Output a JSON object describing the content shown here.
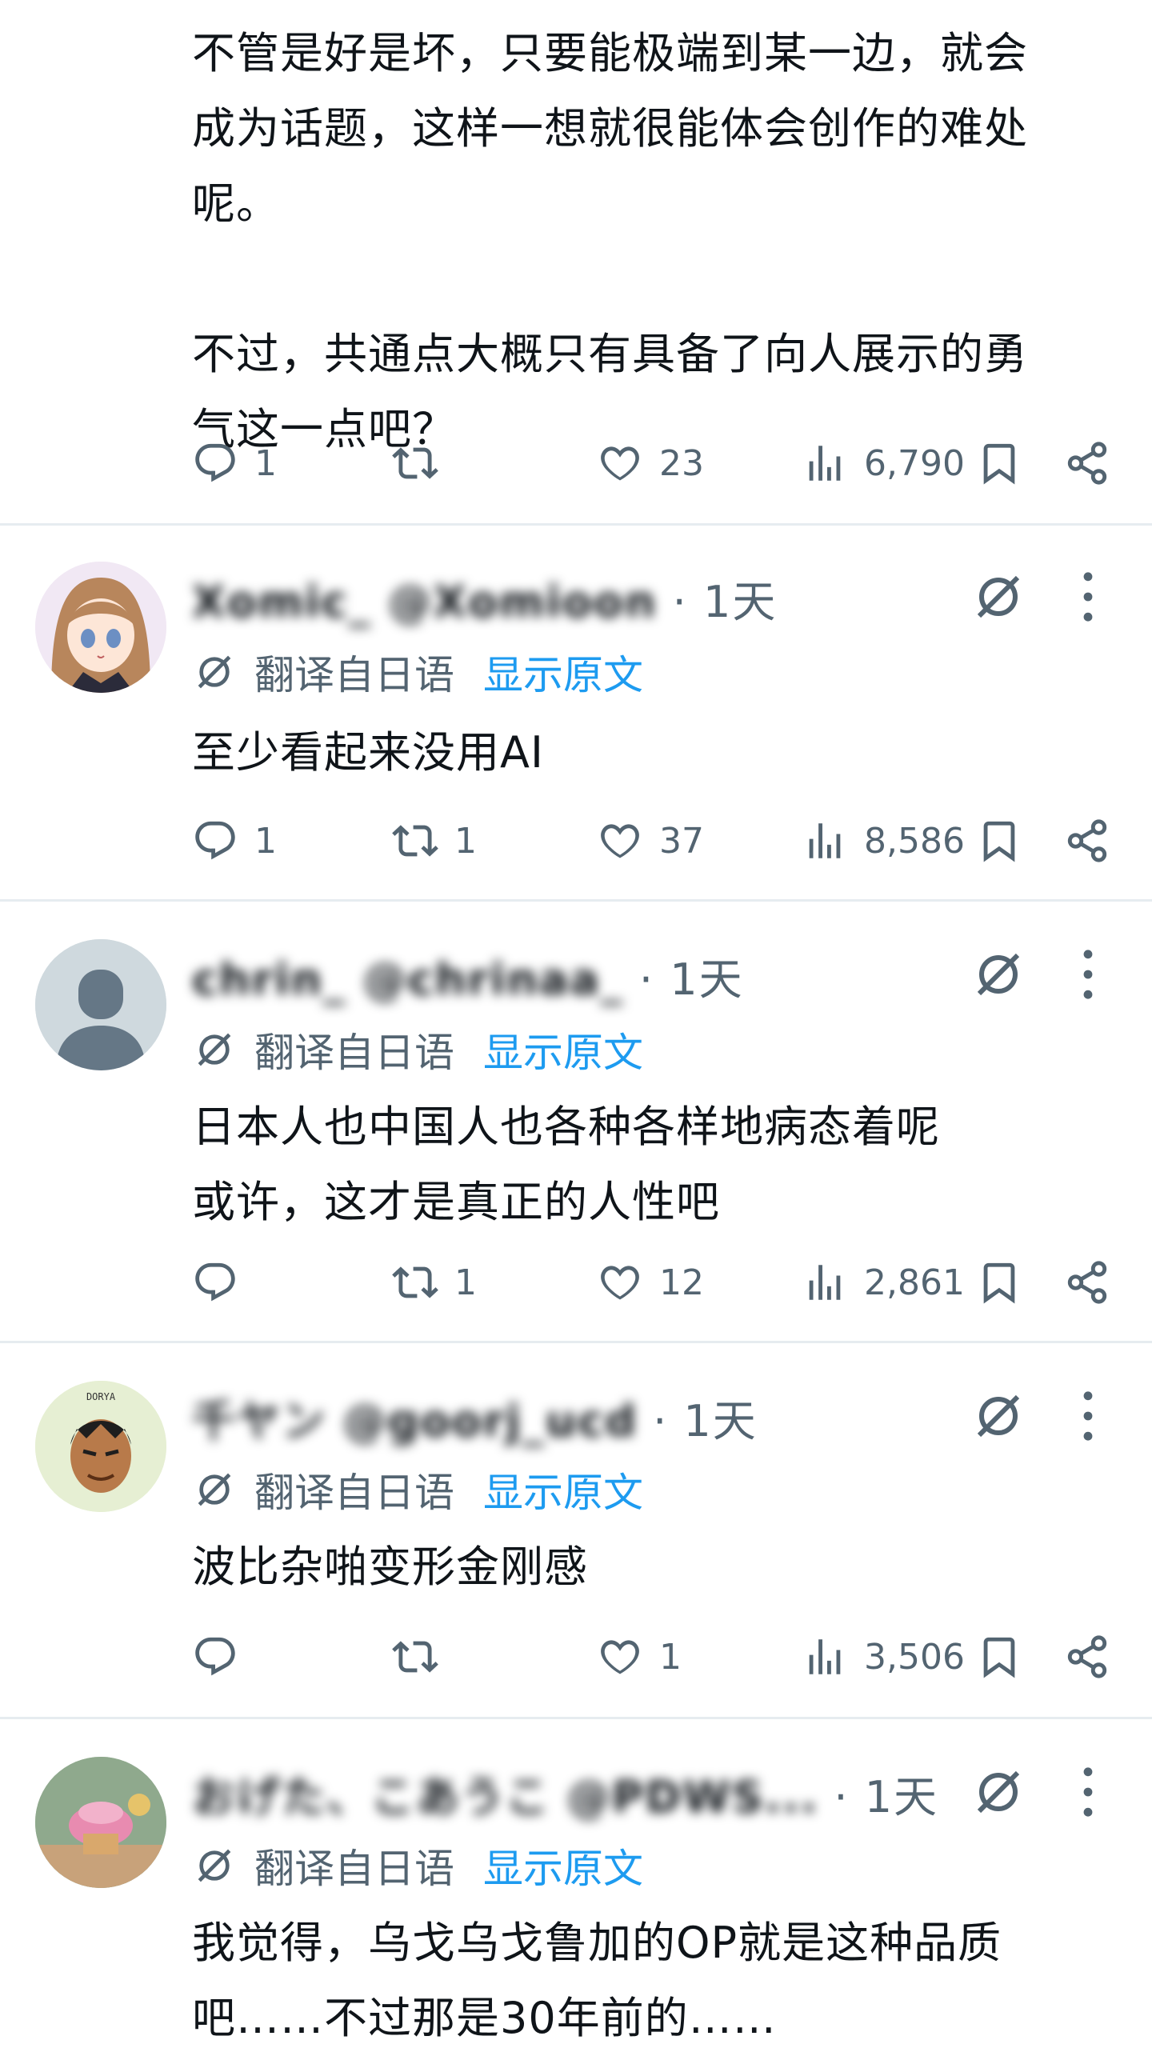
{
  "top_post": {
    "body_lines": [
      "不管是好是坏，只要能极端到某一边，就会",
      "成为话题，这样一想就很能体会创作的难处",
      "呢。",
      "",
      "不过，共通点大概只有具备了向人展示的勇",
      "气这一点吧？"
    ],
    "replies": "1",
    "reposts": "",
    "likes": "23",
    "views": "6,790"
  },
  "translate_label": "翻译自日语",
  "show_original_label": "显示原文",
  "icons": {
    "reply": "reply-icon",
    "repost": "repost-icon",
    "like": "heart-icon",
    "views": "views-icon",
    "bookmark": "bookmark-icon",
    "share": "share-icon",
    "grok": "grok-icon",
    "more": "more-icon",
    "translate": "translate-icon"
  },
  "colors": {
    "text": "#0f1419",
    "muted": "#536471",
    "link": "#1d9bf0",
    "divider": "#e6ecf0"
  },
  "replies": [
    {
      "name_obscured": "Xomic_ @Xomioon",
      "meta": " · 1天",
      "body_lines": [
        "至少看起来没用AI"
      ],
      "replies": "1",
      "reposts": "1",
      "likes": "37",
      "views": "8,586"
    },
    {
      "name_obscured": "chrin_ @chrinaa_",
      "meta": " · 1天",
      "body_lines": [
        "日本人也中国人也各种各样地病态着呢",
        "或许，这才是真正的人性吧"
      ],
      "replies": "",
      "reposts": "1",
      "likes": "12",
      "views": "2,861"
    },
    {
      "name_obscured": "千ヤン @goorj_ucd",
      "meta": " · 1天",
      "body_lines": [
        "波比杂啪变形金刚感"
      ],
      "replies": "",
      "reposts": "",
      "likes": "1",
      "views": "3,506"
    },
    {
      "name_obscured": "おげた、こあうこ @PDWS...",
      "meta": " · 1天",
      "body_lines": [
        "我觉得，乌戈乌戈鲁加的OP就是这种品质",
        "吧……不过那是30年前的……"
      ],
      "replies": "",
      "reposts": "",
      "likes": "",
      "views": ""
    }
  ]
}
